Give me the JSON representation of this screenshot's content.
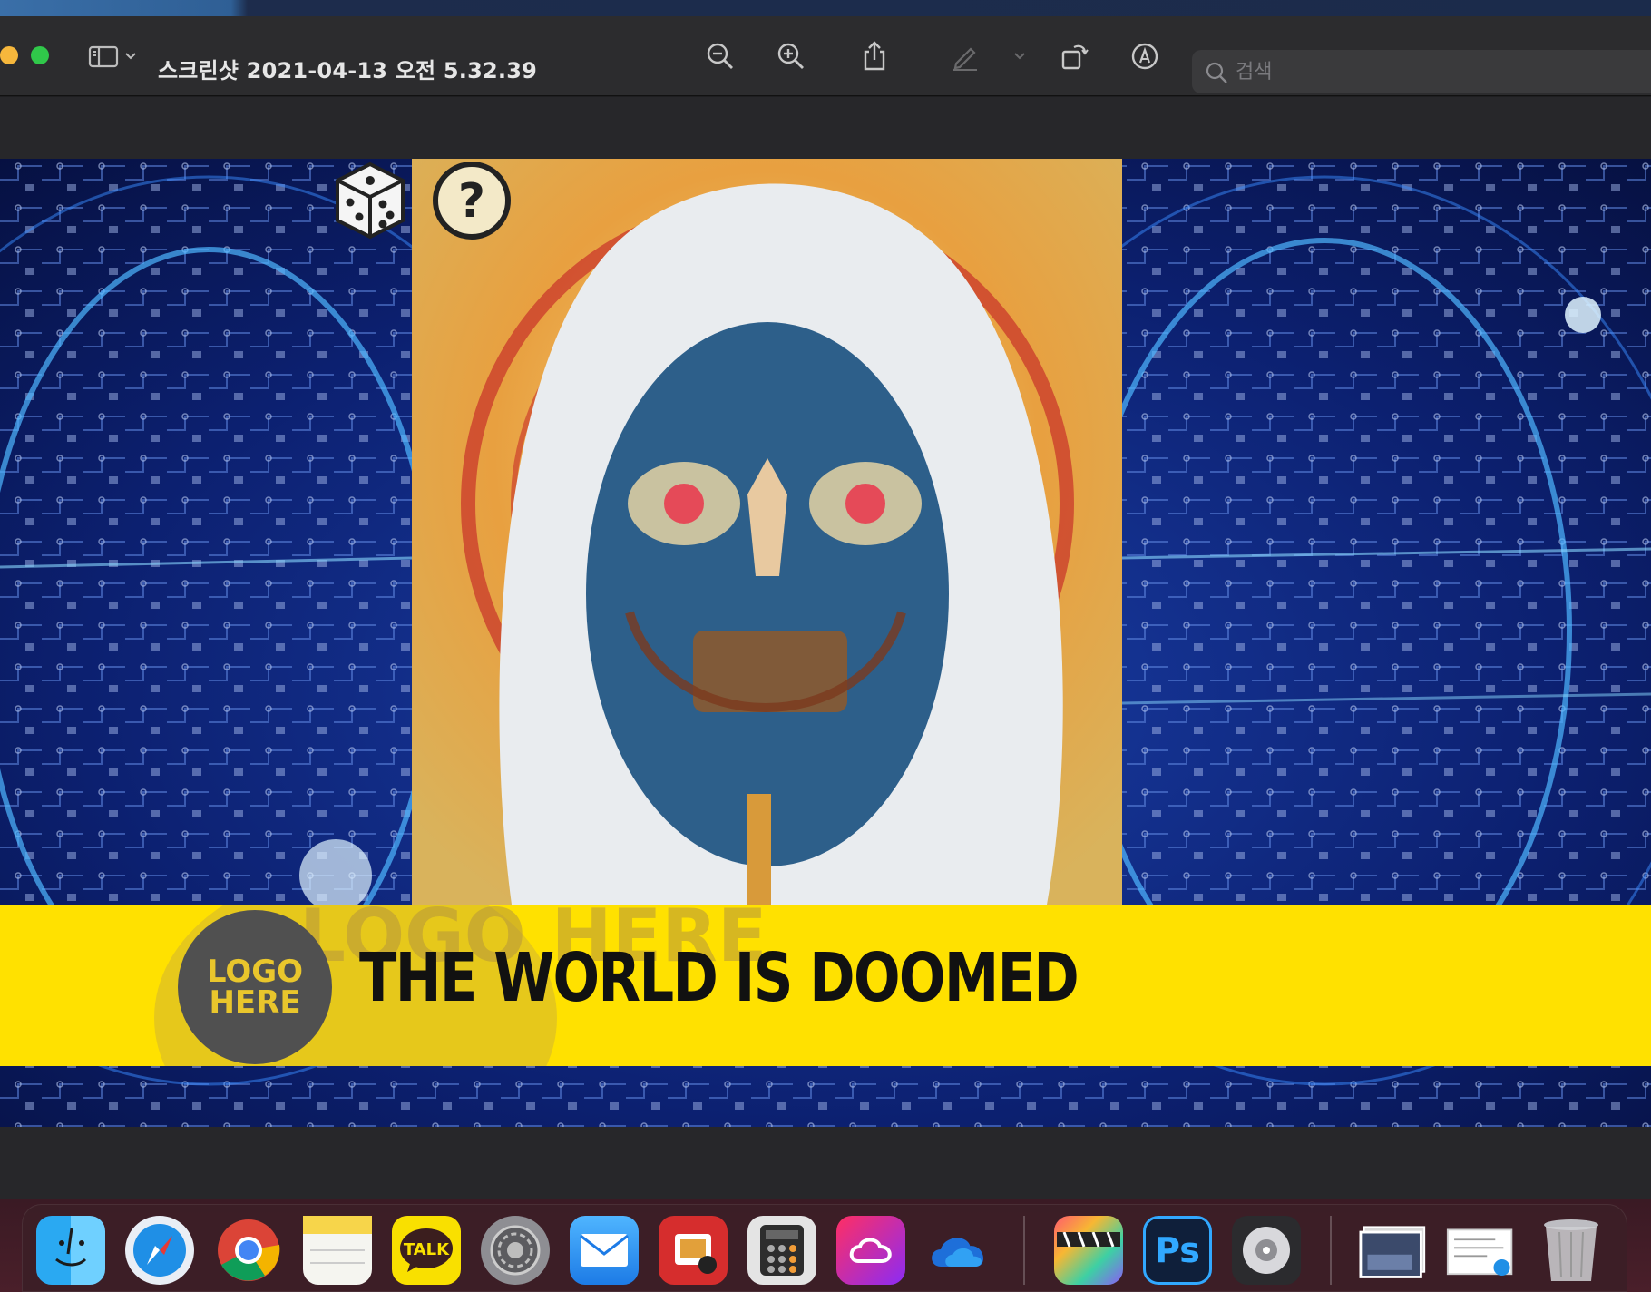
{
  "window": {
    "title": "스크린샷 2021-04-13 오전 5.32.39"
  },
  "toolbar": {
    "search_placeholder": "검색",
    "icons": [
      "sidebar-toggle-icon",
      "chevron-down-icon",
      "zoom-out-icon",
      "zoom-in-icon",
      "share-icon",
      "markup-pen-icon",
      "chevron-down-icon",
      "rotate-icon",
      "annotate-icon",
      "search-icon"
    ]
  },
  "image": {
    "headline": "THE WORLD IS DOOMED",
    "logo_line1": "LOGO",
    "logo_line2": "HERE",
    "ghost_logo_text": "LOGO HERE",
    "colors": {
      "lower_third": "#ffe100",
      "accent_bar": "#3b1fe0",
      "logo_badge": "#505050",
      "logo_text": "#e9c62c"
    }
  },
  "dock": {
    "apps": [
      {
        "name": "Finder",
        "icon": "finder-icon"
      },
      {
        "name": "Safari",
        "icon": "safari-icon"
      },
      {
        "name": "Chrome",
        "icon": "chrome-icon"
      },
      {
        "name": "Notes",
        "icon": "notes-icon"
      },
      {
        "name": "KakaoTalk",
        "icon": "kakaotalk-icon",
        "label": "TALK"
      },
      {
        "name": "System Preferences",
        "icon": "system-preferences-icon"
      },
      {
        "name": "Mail",
        "icon": "mail-icon"
      },
      {
        "name": "Photo Booth",
        "icon": "photo-booth-icon"
      },
      {
        "name": "Calculator",
        "icon": "calculator-icon"
      },
      {
        "name": "Creative Cloud",
        "icon": "creative-cloud-icon"
      },
      {
        "name": "OneDrive",
        "icon": "onedrive-icon"
      },
      {
        "name": "Final Cut Pro",
        "icon": "final-cut-pro-icon"
      },
      {
        "name": "Photoshop",
        "icon": "photoshop-icon",
        "label": "Ps"
      },
      {
        "name": "Logic Pro",
        "icon": "logic-pro-icon"
      },
      {
        "name": "Downloads Stack",
        "icon": "downloads-stack-icon"
      },
      {
        "name": "Documents Stack",
        "icon": "documents-stack-icon"
      },
      {
        "name": "Trash",
        "icon": "trash-icon"
      }
    ]
  }
}
